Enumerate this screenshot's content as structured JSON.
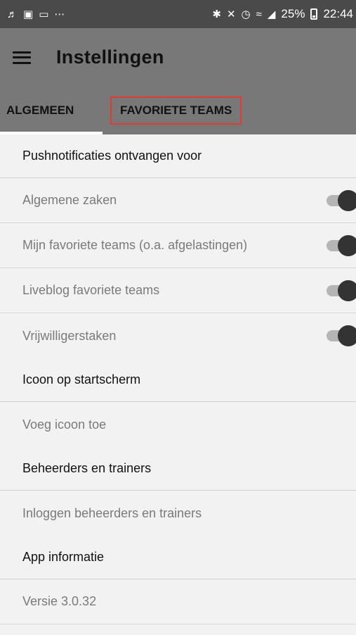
{
  "status_bar": {
    "icons_left": [
      "notification-icon",
      "media-icon",
      "screen-icon",
      "more-icon"
    ],
    "icons_right": [
      "bluetooth-icon",
      "mute-icon",
      "alarm-icon",
      "wifi-icon",
      "signal-icon"
    ],
    "battery": "25%",
    "time": "22:44"
  },
  "app_bar": {
    "title": "Instellingen"
  },
  "tabs": [
    {
      "label": "ALGEMEEN",
      "selected": true
    },
    {
      "label": "FAVORIETE TEAMS",
      "selected": false
    }
  ],
  "sections": {
    "push": {
      "header": "Pushnotificaties ontvangen voor",
      "items": [
        {
          "label": "Algemene zaken",
          "on": true
        },
        {
          "label": "Mijn favoriete teams (o.a. afgelastingen)",
          "on": true
        },
        {
          "label": "Liveblog favoriete teams",
          "on": true
        },
        {
          "label": "Vrijwilligerstaken",
          "on": true
        }
      ]
    },
    "icon": {
      "header": "Icoon op startscherm",
      "item": "Voeg icoon toe"
    },
    "admins": {
      "header": "Beheerders en trainers",
      "item": "Inloggen beheerders en trainers"
    },
    "info": {
      "header": "App informatie",
      "item": "Versie 3.0.32"
    }
  },
  "colors": {
    "app_bar": "#787878",
    "status_bar": "#4a4a4a",
    "highlight": "#e53935",
    "toggle_thumb": "#333333"
  }
}
